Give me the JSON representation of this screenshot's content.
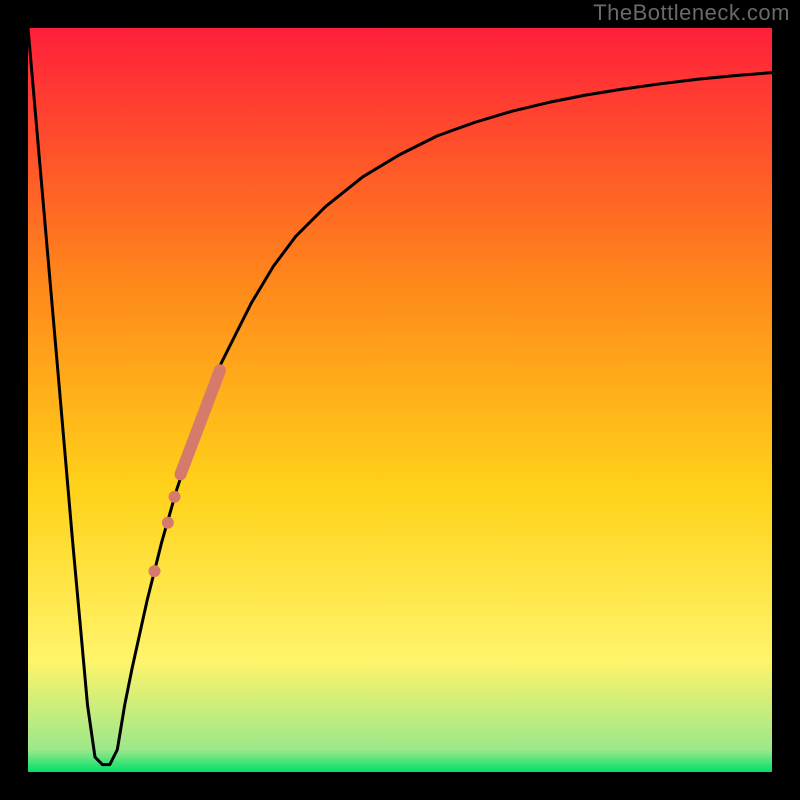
{
  "attribution": "TheBottleneck.com",
  "colors": {
    "frame": "#000000",
    "curve": "#000000",
    "marker": "#d67a6c",
    "grad_top": "#ff1f3a",
    "grad_mid1": "#ff8a1a",
    "grad_mid2": "#ffd21a",
    "grad_mid3": "#fff46a",
    "grad_bottom": "#00e06a"
  },
  "chart_data": {
    "type": "line",
    "title": "",
    "xlabel": "",
    "ylabel": "",
    "xlim": [
      0,
      100
    ],
    "ylim": [
      0,
      100
    ],
    "grid": false,
    "legend": false,
    "series": [
      {
        "name": "bottleneck-curve",
        "x": [
          0,
          2,
          4,
          6,
          7,
          8,
          9,
          10,
          11,
          12,
          13,
          14,
          16,
          18,
          20,
          22,
          24,
          26,
          28,
          30,
          33,
          36,
          40,
          45,
          50,
          55,
          60,
          65,
          70,
          75,
          80,
          85,
          90,
          95,
          100
        ],
        "y": [
          100,
          77,
          54,
          31,
          20,
          9,
          2,
          1,
          1,
          3,
          9,
          14,
          23,
          31,
          38,
          44,
          50,
          55,
          59,
          63,
          68,
          72,
          76,
          80,
          83,
          85.5,
          87.3,
          88.8,
          90,
          91,
          91.8,
          92.5,
          93.1,
          93.6,
          94
        ]
      }
    ],
    "markers": {
      "name": "highlight-segment",
      "points": [
        {
          "x": 17.0,
          "y": 27.0,
          "r": 6
        },
        {
          "x": 18.8,
          "y": 33.5,
          "r": 6
        },
        {
          "x": 19.7,
          "y": 37.0,
          "r": 6
        }
      ],
      "bar": {
        "x1": 20.5,
        "y1": 40.0,
        "x2": 25.8,
        "y2": 54.0,
        "width": 12
      }
    }
  }
}
